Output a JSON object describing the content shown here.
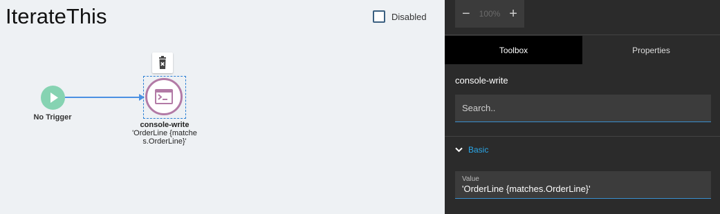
{
  "canvas": {
    "title": "IterateThis",
    "disabled_label": "Disabled",
    "trigger_label": "No Trigger",
    "node": {
      "name": "console-write",
      "subtitle": "'OrderLine {matches.OrderLine}'"
    }
  },
  "panel": {
    "zoom": {
      "minus": "−",
      "value": "100%",
      "plus": "+"
    },
    "tabs": [
      {
        "label": "Toolbox"
      },
      {
        "label": "Properties"
      }
    ],
    "node_name": "console-write",
    "search_placeholder": "Search..",
    "section_label": "Basic",
    "value_field": {
      "label": "Value",
      "value": "'OrderLine {matches.OrderLine}'"
    }
  },
  "colors": {
    "canvas_bg": "#eef1f4",
    "panel_bg": "#2b2b2b",
    "trigger": "#86d3b2",
    "node_ring": "#b27aa6",
    "connector": "#4a90e2",
    "accent": "#2aa7e8"
  }
}
